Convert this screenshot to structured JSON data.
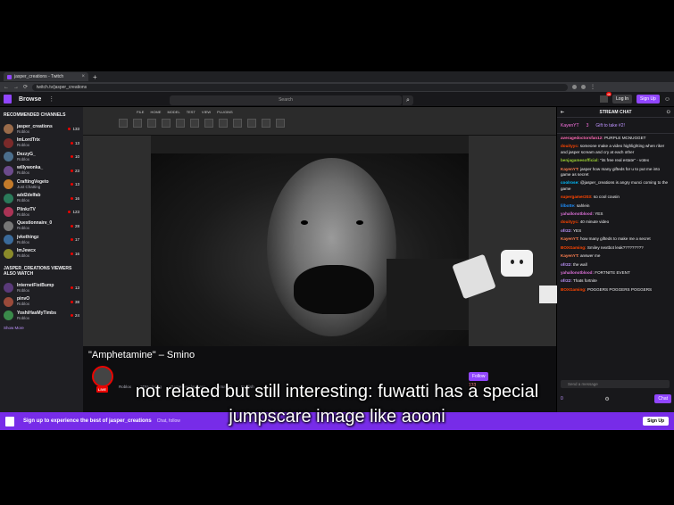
{
  "browser": {
    "tab_title": "jasper_creations - Twitch",
    "url": "twitch.tv/jasper_creations"
  },
  "header": {
    "browse": "Browse",
    "search_placeholder": "Search",
    "notification_count": "46",
    "login": "Log In",
    "signup": "Sign Up"
  },
  "sidebar": {
    "recommended_title": "RECOMMENDED CHANNELS",
    "recommended": [
      {
        "name": "jasper_creations",
        "game": "Roblox",
        "viewers": "133",
        "color": "#9a6b4a"
      },
      {
        "name": "ImLordTrix",
        "game": "Roblox",
        "viewers": "13",
        "color": "#7a2a2a"
      },
      {
        "name": "DezzyG_",
        "game": "Roblox",
        "viewers": "10",
        "color": "#4b6e8c"
      },
      {
        "name": "willywonka_",
        "game": "Roblox",
        "viewers": "23",
        "color": "#6c4b8c"
      },
      {
        "name": "CraftingVegeto",
        "game": "Just Chatting",
        "viewers": "13",
        "color": "#c27a2a"
      },
      {
        "name": "add2delfab",
        "game": "Roblox",
        "viewers": "16",
        "color": "#2a7a5a"
      },
      {
        "name": "PlinkzTV",
        "game": "Roblox",
        "viewers": "123",
        "color": "#aa3355"
      },
      {
        "name": "Questionnaire_0",
        "game": "Roblox",
        "viewers": "28",
        "color": "#777777"
      },
      {
        "name": "jvkethingz",
        "game": "Roblox",
        "viewers": "17",
        "color": "#3a6a9a"
      },
      {
        "name": "ImJewcx",
        "game": "Roblox",
        "viewers": "16",
        "color": "#8a8a2a"
      }
    ],
    "also_watch_title": "JASPER_CREATIONS VIEWERS ALSO WATCH",
    "also_watch": [
      {
        "name": "InternetFistBump",
        "game": "Roblox",
        "viewers": "13",
        "color": "#5a3a7a"
      },
      {
        "name": "pinvO",
        "game": "Roblox",
        "viewers": "38",
        "color": "#9a4a3a"
      },
      {
        "name": "YoshiHasMyTimbs",
        "game": "Roblox",
        "viewers": "24",
        "color": "#3a8a4a"
      }
    ],
    "show_more": "Show More"
  },
  "stream": {
    "title": "\"Amphetamine\" – Smino",
    "live": "LIVE",
    "tags": [
      "Roblox",
      "3DModeling",
      "GameDevelopment",
      "Animation",
      "English"
    ],
    "follow": "Follow",
    "viewers": "133"
  },
  "chat": {
    "title": "STREAM CHAT",
    "gift_user": "KayenYT",
    "gift_count": "3",
    "gift_label": "Gift to take #2!",
    "messages": [
      {
        "user": "averagedoctorsfan12:",
        "text": "PURPLE MCNUGGET",
        "color": "#ff69b4"
      },
      {
        "user": "douityyc:",
        "text": "someone make a video highlighting when riker and jasper scream and cry at each other",
        "color": "#ff4500"
      },
      {
        "user": "benjagamesofficial:",
        "text": "\"its free real estate\" - votex",
        "color": "#9acd32"
      },
      {
        "user": "KayenYT:",
        "text": "jasper how many gifteds for u to put me into game as secret",
        "color": "#ff7f50"
      },
      {
        "user": "coolrose:",
        "text": "@jasper_creations is angry munci coming to the game",
        "color": "#00bfff"
      },
      {
        "user": "supergamer203:",
        "text": "so cool cousin",
        "color": "#ff4500"
      },
      {
        "user": "lilbotte:",
        "text": "sahlein",
        "color": "#1e90ff"
      },
      {
        "user": "yahallonotblood:",
        "text": "YES",
        "color": "#da70d6"
      },
      {
        "user": "douityyc:",
        "text": "40 minute video",
        "color": "#ff4500"
      },
      {
        "user": "ofr22:",
        "text": "YES",
        "color": "#bf94ff"
      },
      {
        "user": "KayenYT:",
        "text": "how many gifteds to make me a secret",
        "color": "#ff7f50"
      },
      {
        "user": "BOXGaming:",
        "text": "Smiley nextbot leak?????????",
        "color": "#ff4500"
      },
      {
        "user": "KayenYT:",
        "text": "answer me",
        "color": "#ff7f50"
      },
      {
        "user": "ofr22:",
        "text": "the wall",
        "color": "#bf94ff"
      },
      {
        "user": "yahallonotblood:",
        "text": "FORTNITE EVENT",
        "color": "#da70d6"
      },
      {
        "user": "ofr22:",
        "text": "Thats fortnite",
        "color": "#bf94ff"
      },
      {
        "user": "BOXGaming:",
        "text": "POGGERS POGGERS POGGERS",
        "color": "#ff4500"
      }
    ],
    "input_placeholder": "Send a message",
    "points": "0",
    "chat_button": "Chat"
  },
  "banner": {
    "text": "Sign up to experience the best of jasper_creations",
    "subtext": "Chat, follow",
    "signup": "Sign Up"
  },
  "subtitle": {
    "line1": "not related but still interesting: fuwatti has a special",
    "line2": "jumpscare image like aooni"
  }
}
